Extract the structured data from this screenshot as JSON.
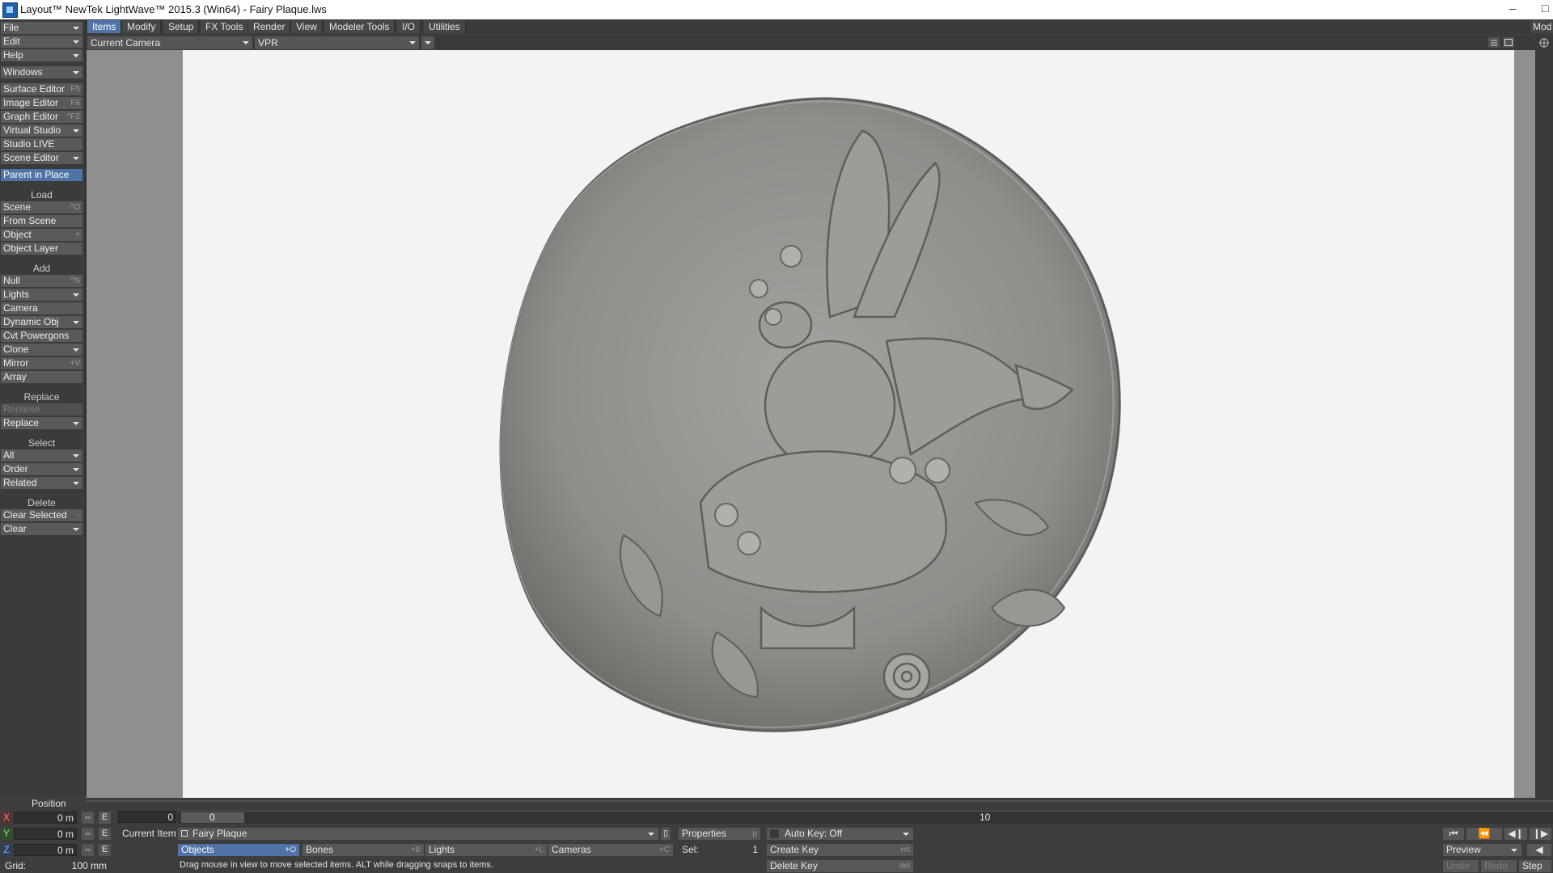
{
  "window": {
    "title": "Layout™ NewTek LightWave™ 2015.3 (Win64) - Fairy Plaque.lws",
    "minimize_glyph": "–",
    "maximize_glyph": "□"
  },
  "left_panel": {
    "top_menus": [
      {
        "label": "File",
        "dropdown": true
      },
      {
        "label": "Edit",
        "dropdown": true
      },
      {
        "label": "Help",
        "dropdown": true
      }
    ],
    "windows": {
      "label": "Windows",
      "dropdown": true
    },
    "editors": [
      {
        "label": "Surface Editor",
        "shortcut": "F5"
      },
      {
        "label": "Image Editor",
        "shortcut": "F6"
      },
      {
        "label": "Graph Editor",
        "shortcut": "^F2"
      },
      {
        "label": "Virtual Studio",
        "dropdown": true
      },
      {
        "label": "Studio LIVE"
      },
      {
        "label": "Scene Editor",
        "dropdown": true
      }
    ],
    "parent_in_place": "Parent in Place",
    "load": {
      "heading": "Load",
      "items": [
        {
          "label": "Scene",
          "shortcut": "^O"
        },
        {
          "label": "From Scene"
        },
        {
          "label": "Object",
          "shortcut": "+"
        },
        {
          "label": "Object Layer"
        }
      ]
    },
    "add": {
      "heading": "Add",
      "items": [
        {
          "label": "Null",
          "shortcut": "^N"
        },
        {
          "label": "Lights",
          "dropdown": true
        },
        {
          "label": "Camera"
        },
        {
          "label": "Dynamic Obj",
          "dropdown": true
        },
        {
          "label": "Cvt Powergons"
        },
        {
          "label": "Clone",
          "dropdown": true
        },
        {
          "label": "Mirror",
          "shortcut": "+V"
        },
        {
          "label": "Array"
        }
      ]
    },
    "replace": {
      "heading": "Replace",
      "items": [
        {
          "label": "Rename",
          "disabled": true
        },
        {
          "label": "Replace",
          "dropdown": true
        }
      ]
    },
    "select": {
      "heading": "Select",
      "items": [
        {
          "label": "All",
          "dropdown": true
        },
        {
          "label": "Order",
          "dropdown": true
        },
        {
          "label": "Related",
          "dropdown": true
        }
      ]
    },
    "delete": {
      "heading": "Delete",
      "items": [
        {
          "label": "Clear Selected",
          "shortcut": "-"
        },
        {
          "label": "Clear",
          "dropdown": true
        }
      ]
    }
  },
  "menubar": {
    "tabs": [
      "Items",
      "Modify",
      "Setup",
      "FX Tools",
      "Render",
      "View",
      "Modeler Tools",
      "I/O",
      "Utilities"
    ],
    "active": "Items",
    "right_label": "Mod"
  },
  "viewport": {
    "camera_select": "Current Camera",
    "render_mode": "VPR"
  },
  "timeline": {
    "start_frame": "0",
    "marker_value": "0",
    "tick_label_10": "10"
  },
  "bottom": {
    "position_label": "Position",
    "axes": [
      {
        "axis": "X",
        "value": "0 m",
        "color": "#d94a4a"
      },
      {
        "axis": "Y",
        "value": "0 m",
        "color": "#5fcf5f"
      },
      {
        "axis": "Z",
        "value": "0 m",
        "color": "#5a8ee0"
      }
    ],
    "env_button": "E",
    "grid_label": "Grid:",
    "grid_value": "100 mm",
    "current_item_label": "Current Item",
    "current_item_value": "Fairy Plaque",
    "properties": {
      "label": "Properties",
      "shortcut": "p"
    },
    "auto_key": "Auto Key: Off",
    "item_types": [
      {
        "label": "Objects",
        "shortcut": "+O",
        "selected": true
      },
      {
        "label": "Bones",
        "shortcut": "+B"
      },
      {
        "label": "Lights",
        "shortcut": "+L"
      },
      {
        "label": "Cameras",
        "shortcut": "+C"
      }
    ],
    "sel_label": "Sel:",
    "sel_value": "1",
    "create_key": {
      "label": "Create Key",
      "shortcut": "ret"
    },
    "delete_key": {
      "label": "Delete Key",
      "shortcut": "del"
    },
    "status_hint": "Drag mouse in view to move selected items. ALT while dragging snaps to items.",
    "preview": "Preview",
    "undo": "Undo",
    "redo": "Redo",
    "step": "Step"
  }
}
